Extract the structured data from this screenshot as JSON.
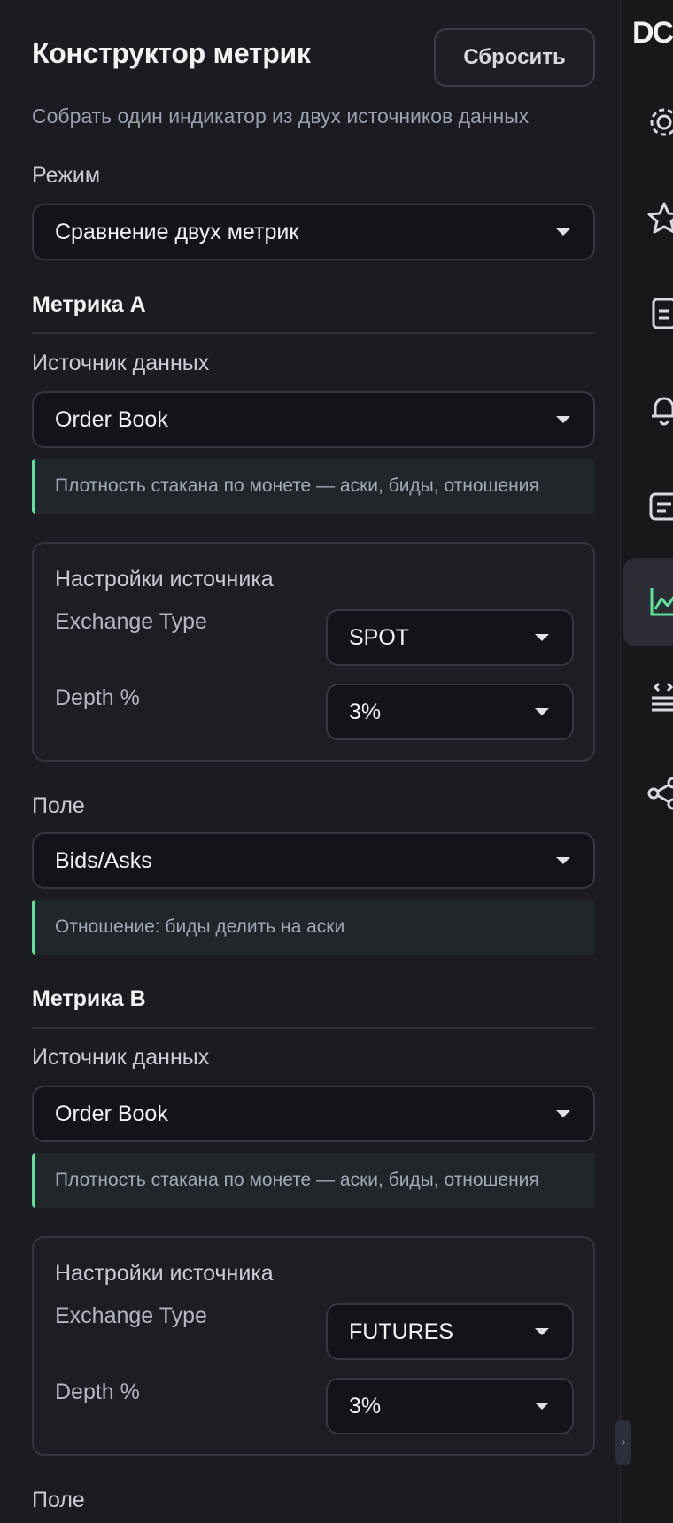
{
  "header": {
    "title": "Конструктор метрик",
    "reset_label": "Сбросить",
    "subtitle": "Собрать один индикатор из двух источников данных"
  },
  "mode": {
    "label": "Режим",
    "value": "Сравнение двух метрик"
  },
  "metric_a": {
    "title": "Метрика A",
    "source_label": "Источник данных",
    "source_value": "Order Book",
    "source_hint": "Плотность стакана по монете — аски, биды, отношения",
    "settings_title": "Настройки источника",
    "exchange_type_label": "Exchange Type",
    "exchange_type_value": "SPOT",
    "depth_label": "Depth %",
    "depth_value": "3%",
    "field_label": "Поле",
    "field_value": "Bids/Asks",
    "field_hint": "Отношение: биды делить на аски"
  },
  "metric_b": {
    "title": "Метрика B",
    "source_label": "Источник данных",
    "source_value": "Order Book",
    "source_hint": "Плотность стакана по монете — аски, биды, отношения",
    "settings_title": "Настройки источника",
    "exchange_type_label": "Exchange Type",
    "exchange_type_value": "FUTURES",
    "depth_label": "Depth %",
    "depth_value": "3%",
    "field_label": "Поле"
  },
  "rail": {
    "logo": "DC",
    "items": [
      "gear-icon",
      "star-icon",
      "document-icon",
      "bell-icon",
      "terminal-icon",
      "chart-icon",
      "code-list-icon",
      "share-icon"
    ],
    "active_item": "chart-icon",
    "collapse_glyph": "›"
  },
  "colors": {
    "accent": "#5fe29b",
    "background": "#1a1c21",
    "input_bg": "#13141a"
  }
}
